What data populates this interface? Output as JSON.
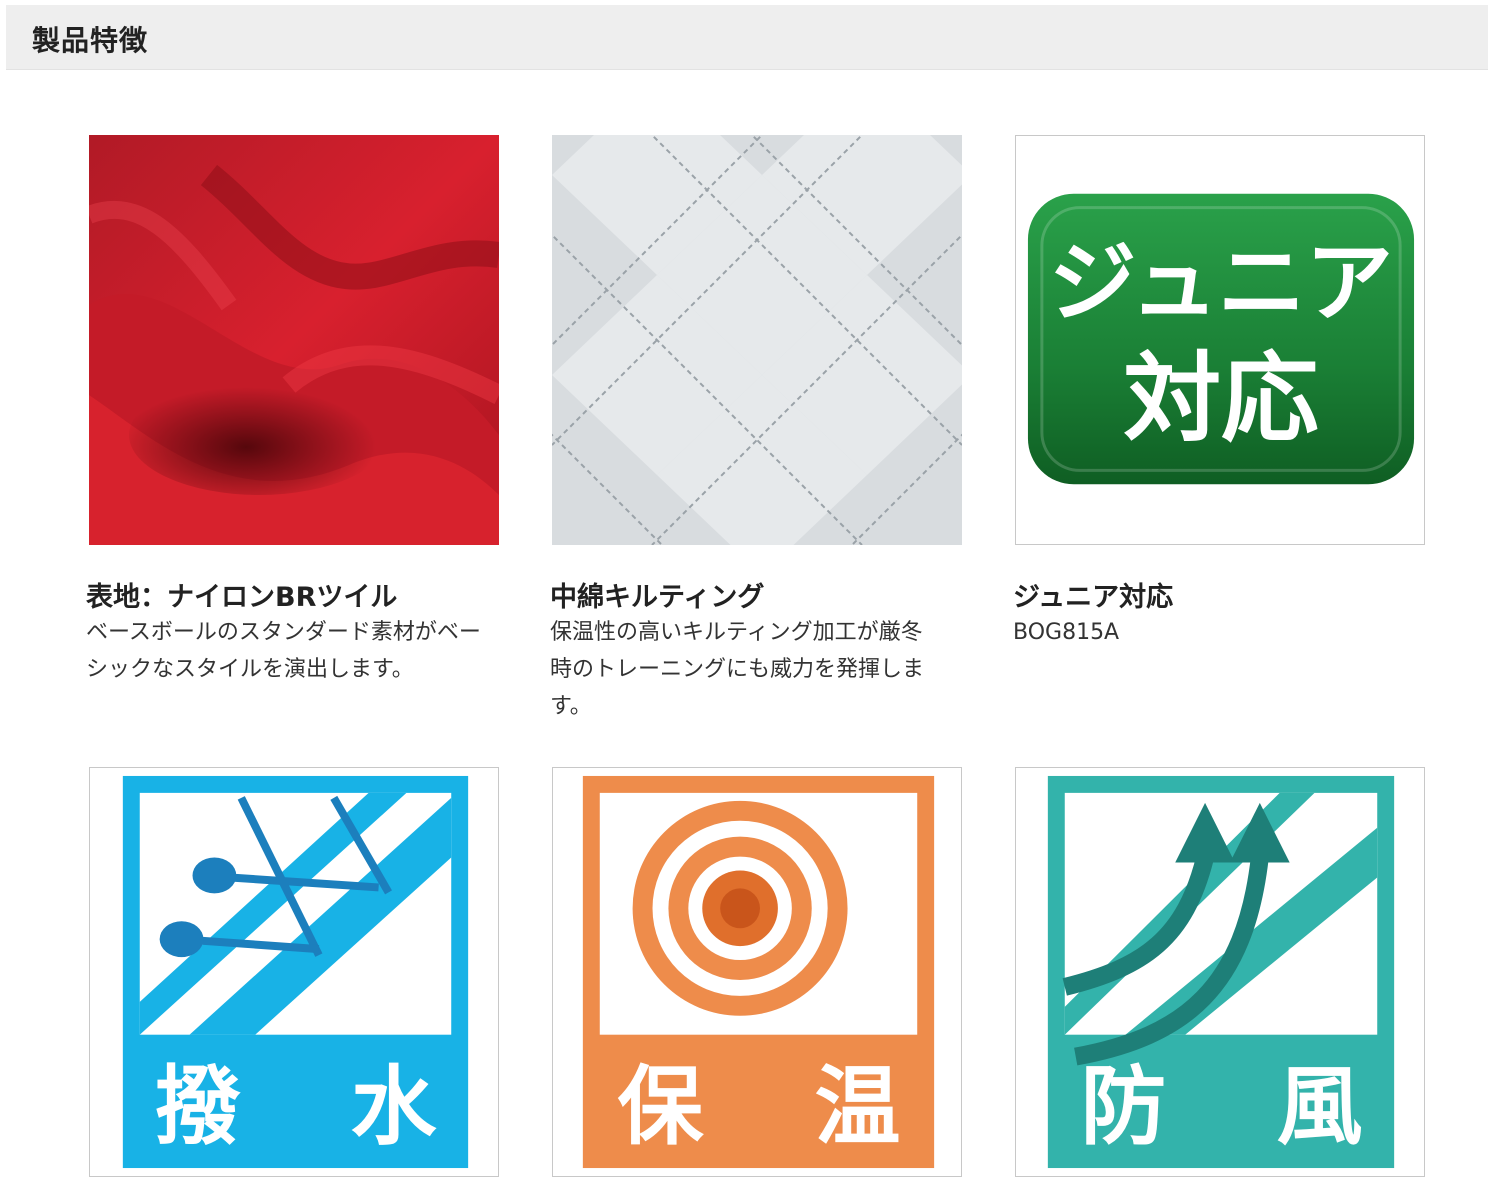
{
  "section": {
    "title": "製品特徴"
  },
  "features": [
    {
      "title": "表地：ナイロンBRツイル",
      "desc_lines": [
        "ベースボールのスタンダード素材がベー",
        "シックなスタイルを演出します。"
      ]
    },
    {
      "title": "中綿キルティング",
      "desc_lines": [
        "保温性の高いキルティング加工が厳冬",
        "時のトレーニングにも威力を発揮しま",
        "す。"
      ]
    },
    {
      "title": "ジュニア対応",
      "code": "BOG815A"
    }
  ],
  "junior_badge": {
    "line1": "ジュニア",
    "line2": "対応",
    "color": "#1f8a3c"
  },
  "icons": [
    {
      "name": "water-repellent-icon",
      "chars": [
        "撥",
        "水"
      ],
      "color": "#18b2e6"
    },
    {
      "name": "heat-retention-icon",
      "chars": [
        "保",
        "温"
      ],
      "color": "#ee8c4b"
    },
    {
      "name": "windproof-icon",
      "chars": [
        "防",
        "風"
      ],
      "color": "#33b3ab"
    }
  ]
}
